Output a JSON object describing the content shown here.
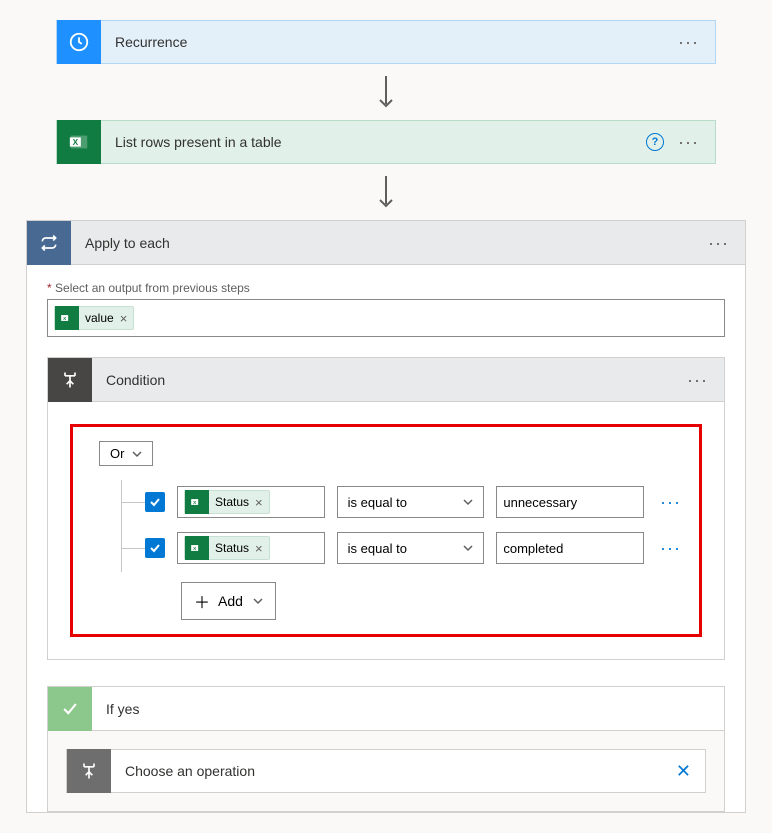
{
  "steps": {
    "recurrence": {
      "title": "Recurrence"
    },
    "list_rows": {
      "title": "List rows present in a table"
    },
    "apply_to_each": {
      "title": "Apply to each"
    },
    "condition": {
      "title": "Condition"
    },
    "if_yes": {
      "title": "If yes"
    },
    "choose_op": {
      "title": "Choose an operation"
    }
  },
  "apply": {
    "output_label": "Select an output from previous steps",
    "token_value": "value"
  },
  "condition": {
    "logic_op": "Or",
    "rows": [
      {
        "field": "Status",
        "operator": "is equal to",
        "value": "unnecessary"
      },
      {
        "field": "Status",
        "operator": "is equal to",
        "value": "completed"
      }
    ],
    "add_label": "Add"
  }
}
